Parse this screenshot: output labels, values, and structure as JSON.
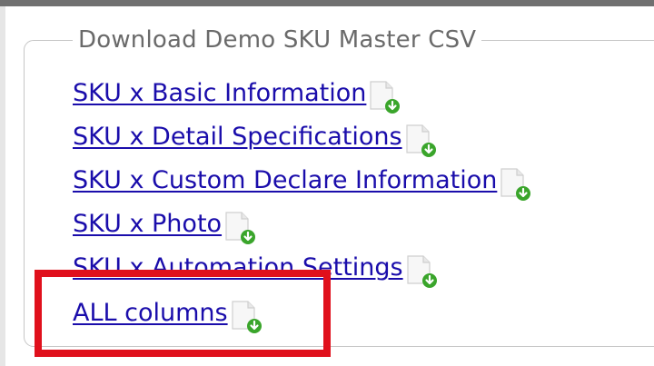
{
  "panel": {
    "legend": "Download Demo SKU Master CSV"
  },
  "links": [
    {
      "label": "SKU x Basic Information",
      "icon": "download-file-icon"
    },
    {
      "label": "SKU x Detail Specifications",
      "icon": "download-file-icon"
    },
    {
      "label": "SKU x Custom Declare Information",
      "icon": "download-file-icon"
    },
    {
      "label": "SKU x Photo",
      "icon": "download-file-icon"
    },
    {
      "label": "SKU x Automation Settings",
      "icon": "download-file-icon"
    },
    {
      "label": "ALL columns",
      "icon": "download-file-icon"
    }
  ],
  "colors": {
    "link": "#1a0dab",
    "highlight": "#e0101c",
    "icon_badge": "#3aa52b"
  }
}
